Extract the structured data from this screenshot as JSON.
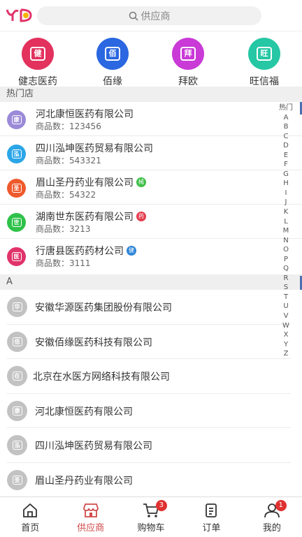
{
  "search": {
    "placeholder": "供应商"
  },
  "colors": {
    "accent": "#d14a4a",
    "featured": [
      "#e2325d",
      "#2a67e0",
      "#c93ad6",
      "#26c7a4"
    ],
    "hot_icons": [
      "#9a8ad8",
      "#2ba6e8",
      "#ef5a2c",
      "#2fc24a",
      "#e0336a"
    ],
    "hot_badges": [
      "#3fbf49",
      "#e53e4f",
      "#2f86d8"
    ]
  },
  "featured": [
    {
      "label": "健志医药",
      "glyph": "健"
    },
    {
      "label": "佰缘",
      "glyph": "佰"
    },
    {
      "label": "拜欧",
      "glyph": "拜"
    },
    {
      "label": "旺信福",
      "glyph": "旺"
    }
  ],
  "hot_section": {
    "title": "热门店"
  },
  "hot_shops": [
    {
      "name": "河北康恒医药有限公司",
      "glyph": "康",
      "count_label": "商品数：",
      "count": "123456",
      "badge": ""
    },
    {
      "name": "四川泓坤医药贸易有限公司",
      "glyph": "泓",
      "count_label": "商品数：",
      "count": "543321",
      "badge": ""
    },
    {
      "name": "眉山圣丹药业有限公司",
      "glyph": "圣",
      "count_label": "商品数：",
      "count": "54322",
      "badge": "械"
    },
    {
      "name": "湖南世东医药有限公司",
      "glyph": "世",
      "count_label": "商品数：",
      "count": "3213",
      "badge": "药"
    },
    {
      "name": "行唐县医药药材公司",
      "glyph": "医",
      "count_label": "商品数：",
      "count": "3111",
      "badge": "健"
    }
  ],
  "alpha_section": {
    "title": "A"
  },
  "alpha_shops": [
    {
      "name": "安徽华源医药集团股份有限公司",
      "glyph": "华"
    },
    {
      "name": "安徽佰缘医药科技有限公司",
      "glyph": "佰"
    },
    {
      "name": "北京在水医方网络科技有限公司",
      "glyph": "在"
    },
    {
      "name": "河北康恒医药有限公司",
      "glyph": "康"
    },
    {
      "name": "四川泓坤医药贸易有限公司",
      "glyph": "泓"
    },
    {
      "name": "眉山圣丹药业有限公司",
      "glyph": "圣"
    }
  ],
  "index_letters": [
    "热门",
    "A",
    "B",
    "C",
    "D",
    "E",
    "F",
    "G",
    "H",
    "I",
    "J",
    "K",
    "L",
    "M",
    "N",
    "O",
    "P",
    "Q",
    "R",
    "S",
    "T",
    "U",
    "V",
    "W",
    "X",
    "Y",
    "Z"
  ],
  "tabs": [
    {
      "label": "首页",
      "icon": "home-icon",
      "badge": ""
    },
    {
      "label": "供应商",
      "icon": "shop-icon",
      "badge": ""
    },
    {
      "label": "购物车",
      "icon": "cart-icon",
      "badge": "3"
    },
    {
      "label": "订单",
      "icon": "order-icon",
      "badge": ""
    },
    {
      "label": "我的",
      "icon": "user-icon",
      "badge": "1"
    }
  ]
}
